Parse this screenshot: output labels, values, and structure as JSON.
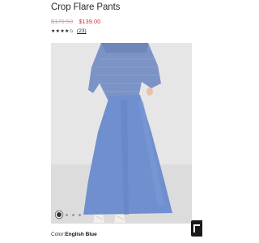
{
  "product": {
    "title": "Crop Flare Pants",
    "old_price": "$179.50",
    "new_price": "$139.00",
    "stars": "★★★★✩",
    "rating_value": 4.5,
    "reviews": "(23)"
  },
  "gallery": {
    "image_icon": "model-photo",
    "dot_count": 4,
    "active_index": 0
  },
  "color": {
    "label": "Color:",
    "value": "English Blue"
  },
  "colors": {
    "sale": "#d6343a",
    "product": "#6f8fcf"
  }
}
